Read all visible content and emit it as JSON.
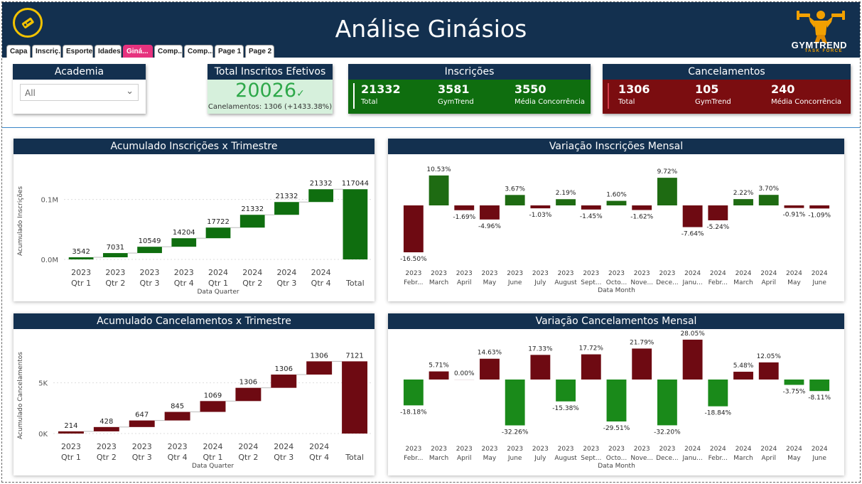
{
  "header": {
    "title": "Análise Ginásios",
    "brand_name": "GYMTREND",
    "brand_sub": "TASK FORCE",
    "tabs": [
      "Capa",
      "Inscriç...",
      "Esporte",
      "Idades",
      "Giná...",
      "Comp...",
      "Comp...",
      "Page 1",
      "Page 2"
    ],
    "active_tab": 4
  },
  "filter": {
    "title": "Academia",
    "value": "All"
  },
  "total_card": {
    "title": "Total Inscritos Efetivos",
    "value": "20026",
    "subtitle": "Canelamentos: 1306 (+1433.38%)"
  },
  "inscricoes": {
    "title": "Inscrições",
    "total_value": "21332",
    "total_label": "Total",
    "gym_value": "3581",
    "gym_label": "GymTrend",
    "avg_value": "3550",
    "avg_label": "Média Concorrência"
  },
  "cancelamentos": {
    "title": "Cancelamentos",
    "total_value": "1306",
    "total_label": "Total",
    "gym_value": "105",
    "gym_label": "GymTrend",
    "avg_value": "240",
    "avg_label": "Média Concorrência"
  },
  "colors": {
    "navy": "#13304f",
    "green": "#0f6e0f",
    "dark_red": "#6e0a12",
    "bright_green": "#1a8a1a",
    "pink_tab": "#e6327e",
    "kpi_green_text": "#2ea84a"
  },
  "chart_data": [
    {
      "id": "insc-waterfall",
      "type": "bar",
      "subtype": "waterfall",
      "title": "Acumulado Inscrições x Trimestre",
      "xlabel": "Data Quarter",
      "ylabel": "Acumulado Inscrições",
      "yticks": [
        "0.0M",
        "0.1M"
      ],
      "ytick_values": [
        0,
        100000
      ],
      "ylim": [
        0,
        128000
      ],
      "categories": [
        [
          "2023",
          "Qtr 1"
        ],
        [
          "2023",
          "Qtr 2"
        ],
        [
          "2023",
          "Qtr 3"
        ],
        [
          "2023",
          "Qtr 4"
        ],
        [
          "2024",
          "Qtr 1"
        ],
        [
          "2024",
          "Qtr 2"
        ],
        [
          "2024",
          "Qtr 3"
        ],
        [
          "2024",
          "Qtr 4"
        ],
        [
          "",
          "Total"
        ]
      ],
      "values": [
        3542,
        7031,
        10549,
        14204,
        17722,
        21332,
        21332,
        21332,
        117044
      ],
      "labels": [
        "3542",
        "7031",
        "10549",
        "14204",
        "17722",
        "21332",
        "21332",
        "21332",
        "117044"
      ],
      "color": "#0f6e0f",
      "grid": true
    },
    {
      "id": "insc-monthly",
      "type": "bar",
      "title": "Variação Inscrições Mensal",
      "xlabel": "Data Month",
      "categories": [
        [
          "2023",
          "Febr..."
        ],
        [
          "2023",
          "March"
        ],
        [
          "2023",
          "April"
        ],
        [
          "2023",
          "May"
        ],
        [
          "2023",
          "June"
        ],
        [
          "2023",
          "July"
        ],
        [
          "2023",
          "August"
        ],
        [
          "2023",
          "Sept..."
        ],
        [
          "2023",
          "Octo..."
        ],
        [
          "2023",
          "Nove..."
        ],
        [
          "2023",
          "Dece..."
        ],
        [
          "2024",
          "Janu..."
        ],
        [
          "2024",
          "Febr..."
        ],
        [
          "2024",
          "March"
        ],
        [
          "2024",
          "April"
        ],
        [
          "2024",
          "May"
        ],
        [
          "2024",
          "June"
        ]
      ],
      "values": [
        -16.5,
        10.53,
        -1.69,
        -4.96,
        3.67,
        -1.03,
        2.19,
        -1.45,
        1.6,
        -1.62,
        9.72,
        -7.64,
        -5.24,
        2.22,
        3.7,
        -0.91,
        -1.09
      ],
      "labels": [
        "-16.50%",
        "10.53%",
        "-1.69%",
        "-4.96%",
        "3.67%",
        "-1.03%",
        "2.19%",
        "-1.45%",
        "1.60%",
        "-1.62%",
        "9.72%",
        "-7.64%",
        "-5.24%",
        "2.22%",
        "3.70%",
        "-0.91%",
        "-1.09%"
      ],
      "positive_color": "#1e6b12",
      "negative_color": "#6e0a12",
      "grid": false
    },
    {
      "id": "canc-waterfall",
      "type": "bar",
      "subtype": "waterfall",
      "title": "Acumulado Cancelamentos x Trimestre",
      "xlabel": "Data Quarter",
      "ylabel": "Acumulado Cancelamentos",
      "yticks": [
        "0K",
        "5K"
      ],
      "ytick_values": [
        0,
        5000
      ],
      "ylim": [
        0,
        7500
      ],
      "categories": [
        [
          "2023",
          "Qtr 1"
        ],
        [
          "2023",
          "Qtr 2"
        ],
        [
          "2023",
          "Qtr 3"
        ],
        [
          "2023",
          "Qtr 4"
        ],
        [
          "2024",
          "Qtr 1"
        ],
        [
          "2024",
          "Qtr 2"
        ],
        [
          "2024",
          "Qtr 3"
        ],
        [
          "2024",
          "Qtr 4"
        ],
        [
          "",
          "Total"
        ]
      ],
      "values": [
        214,
        428,
        647,
        845,
        1069,
        1306,
        1306,
        1306,
        7121
      ],
      "labels": [
        "214",
        "428",
        "647",
        "845",
        "1069",
        "1306",
        "1306",
        "1306",
        "7121"
      ],
      "color": "#6e0a12",
      "grid": true
    },
    {
      "id": "canc-monthly",
      "type": "bar",
      "title": "Variação Cancelamentos Mensal",
      "xlabel": "Data Month",
      "categories": [
        [
          "2023",
          "Febr..."
        ],
        [
          "2023",
          "March"
        ],
        [
          "2023",
          "April"
        ],
        [
          "2023",
          "May"
        ],
        [
          "2023",
          "June"
        ],
        [
          "2023",
          "July"
        ],
        [
          "2023",
          "August"
        ],
        [
          "2023",
          "Sept..."
        ],
        [
          "2023",
          "Octo..."
        ],
        [
          "2023",
          "Nove..."
        ],
        [
          "2023",
          "Dece..."
        ],
        [
          "2024",
          "Janu..."
        ],
        [
          "2024",
          "Febr..."
        ],
        [
          "2024",
          "March"
        ],
        [
          "2024",
          "April"
        ],
        [
          "2024",
          "May"
        ],
        [
          "2024",
          "June"
        ]
      ],
      "values": [
        -18.18,
        5.71,
        0.0,
        14.63,
        -32.26,
        17.33,
        -15.38,
        17.72,
        -29.51,
        21.79,
        -32.2,
        28.05,
        -18.84,
        5.48,
        12.05,
        -3.75,
        -8.11
      ],
      "labels": [
        "-18.18%",
        "5.71%",
        "0.00%",
        "14.63%",
        "-32.26%",
        "17.33%",
        "-15.38%",
        "17.72%",
        "-29.51%",
        "21.79%",
        "-32.20%",
        "28.05%",
        "-18.84%",
        "5.48%",
        "12.05%",
        "-3.75%",
        "-8.11%"
      ],
      "positive_color": "#6e0a12",
      "negative_color": "#1a8a1a",
      "grid": false
    }
  ]
}
